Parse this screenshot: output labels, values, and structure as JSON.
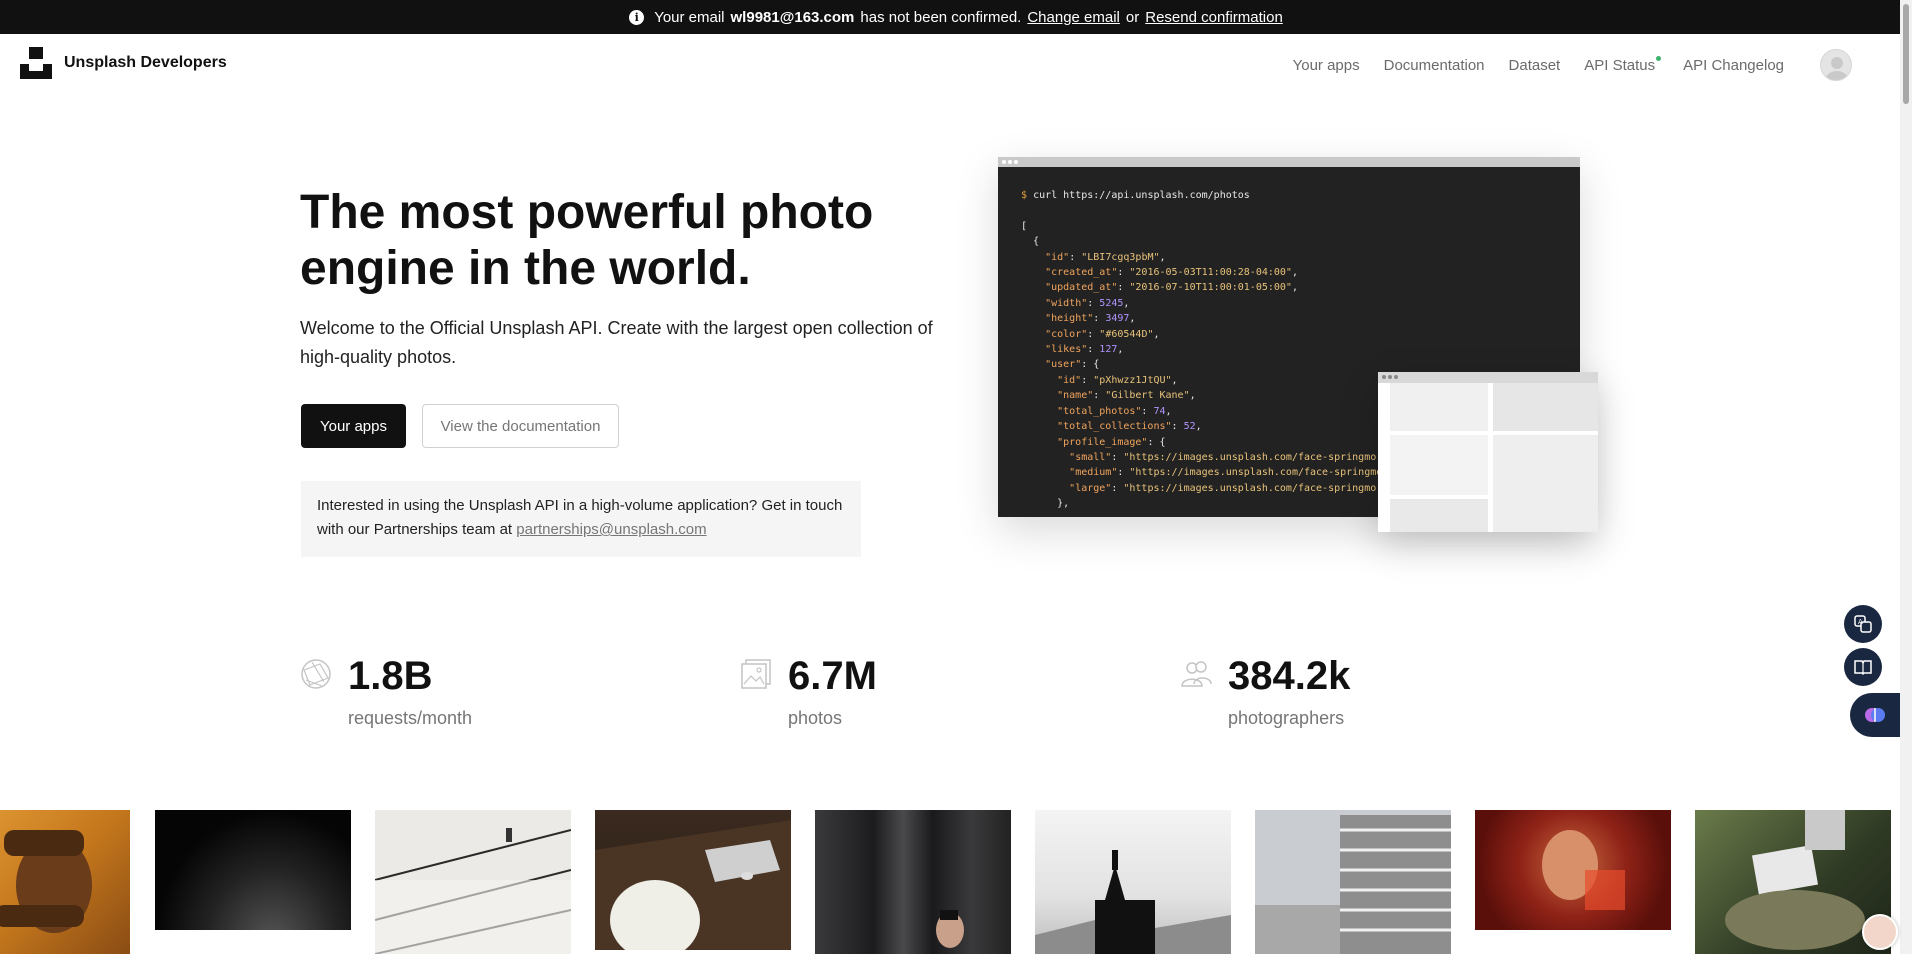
{
  "banner": {
    "prefix": "Your email",
    "email": "wl9981@163.com",
    "middle": "has not been confirmed.",
    "change_email": "Change email",
    "or": "or",
    "resend": "Resend confirmation",
    "icon": "info-icon"
  },
  "header": {
    "brand": "Unsplash Developers",
    "nav": [
      "Your apps",
      "Documentation",
      "Dataset",
      "API Status",
      "API Changelog"
    ],
    "status_dot_color": "#3cb46e"
  },
  "hero": {
    "title": "The most powerful photo engine in the world.",
    "subtitle": "Welcome to the Official Unsplash API. Create with the largest open collection of high-quality photos.",
    "primary_button": "Your apps",
    "secondary_button": "View the documentation",
    "partner_text": "Interested in using the Unsplash API in a high-volume application? Get in touch with our Partnerships team at",
    "partner_email": "partnerships@unsplash.com"
  },
  "code": {
    "prompt": "$",
    "command": "curl https://api.unsplash.com/photos",
    "lines": [
      "[",
      "  {",
      "    \"id\": \"LBI7cgq3pbM\",",
      "    \"created_at\": \"2016-05-03T11:00:28-04:00\",",
      "    \"updated_at\": \"2016-07-10T11:00:01-05:00\",",
      "    \"width\": 5245,",
      "    \"height\": 3497,",
      "    \"color\": \"#60544D\",",
      "    \"likes\": 127,",
      "    \"user\": {",
      "      \"id\": \"pXhwzz1JtQU\",",
      "      \"name\": \"Gilbert Kane\",",
      "      \"total_photos\": 74,",
      "      \"total_collections\": 52,",
      "      \"profile_image\": {",
      "        \"small\": \"https://images.unsplash.com/face-springmorning.jpg\",",
      "        \"medium\": \"https://images.unsplash.com/face-springmorning.jpg\",",
      "        \"large\": \"https://images.unsplash.com/face-springmorning.jpg\"",
      "      },"
    ]
  },
  "stats": [
    {
      "value": "1.8B",
      "label": "requests/month",
      "icon": "globe-icon"
    },
    {
      "value": "6.7M",
      "label": "photos",
      "icon": "photos-icon"
    },
    {
      "value": "384.2k",
      "label": "photographers",
      "icon": "people-icon"
    }
  ],
  "photos": [
    {
      "subject": "hands-portrait",
      "color": "#d98a2a"
    },
    {
      "subject": "dark-surface",
      "color": "#1a1a1a"
    },
    {
      "subject": "white-staircase",
      "color": "#e9e6e1"
    },
    {
      "subject": "laptop-desk",
      "color": "#3b2a1e"
    },
    {
      "subject": "dark-curtain",
      "color": "#2a2a2c"
    },
    {
      "subject": "black-church",
      "color": "#d9d9d9"
    },
    {
      "subject": "building-facade",
      "color": "#c6c9cc"
    },
    {
      "subject": "red-portrait",
      "color": "#9c2a1e"
    },
    {
      "subject": "plants-laptop",
      "color": "#3f4a30"
    }
  ],
  "side_buttons": [
    "translate-icon",
    "reader-icon",
    "brain-icon"
  ]
}
